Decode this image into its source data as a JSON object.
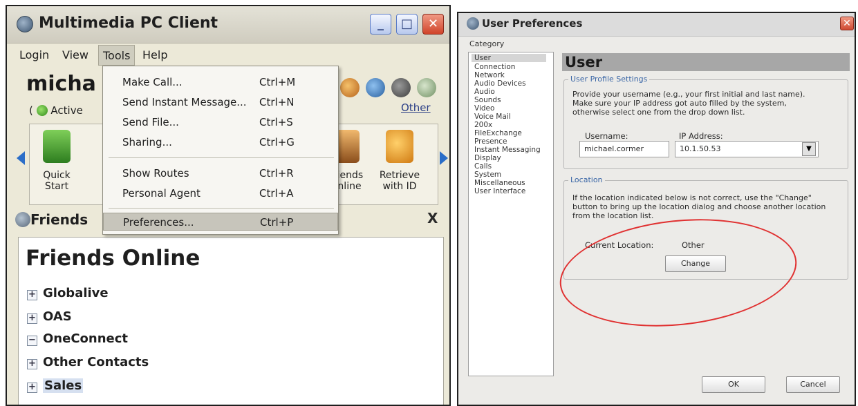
{
  "client": {
    "title": "Multimedia PC Client",
    "window_controls": {
      "minimize": "_",
      "maximize": "□",
      "close": "✕"
    },
    "menus": [
      "Login",
      "View",
      "Tools",
      "Help"
    ],
    "user_name": "micha",
    "status": "Active",
    "other_link": "Other",
    "toolbar_buttons": [
      "Quick Start",
      "Friends Online",
      "Retrieve with ID"
    ],
    "tools_menu": {
      "items": [
        {
          "label": "Make Call...",
          "shortcut": "Ctrl+M"
        },
        {
          "label": "Send Instant Message...",
          "shortcut": "Ctrl+N"
        },
        {
          "label": "Send File...",
          "shortcut": "Ctrl+S"
        },
        {
          "label": "Sharing...",
          "shortcut": "Ctrl+G"
        },
        {
          "label": "Show Routes",
          "shortcut": "Ctrl+R"
        },
        {
          "label": "Personal Agent",
          "shortcut": "Ctrl+A"
        },
        {
          "label": "Preferences...",
          "shortcut": "Ctrl+P"
        }
      ]
    },
    "friends_tab": "Friends",
    "friends_close": "X",
    "friends_title": "Friends Online",
    "groups": [
      "Globalive",
      "OAS",
      "OneConnect",
      "Other Contacts",
      "Sales"
    ]
  },
  "prefs": {
    "title": "User Preferences",
    "close": "✕",
    "category_label": "Category",
    "categories": [
      "User",
      "Connection",
      "Network",
      "Audio Devices",
      "Audio",
      "Sounds",
      "Video",
      "Voice Mail",
      "200x",
      "FileExchange",
      "Presence",
      "Instant Messaging",
      "Display",
      "Calls",
      "System",
      "Miscellaneous",
      "User Interface"
    ],
    "section_title": "User",
    "profile_legend": "User Profile Settings",
    "profile_text": [
      "Provide your username (e.g., your first initial and last name).",
      "Make sure your IP address got auto filled by the system,",
      "otherwise select one from the drop down list."
    ],
    "username_label": "Username:",
    "username_value": "michael.cormer",
    "ip_label": "IP Address:",
    "ip_value": "10.1.50.53",
    "location_legend": "Location",
    "location_text": [
      "If the location indicated below is not correct, use the \"Change\"",
      "button to bring up the location dialog and choose another location",
      "from the location list."
    ],
    "current_location_label": "Current Location:",
    "current_location_value": "Other",
    "change_button": "Change",
    "ok_button": "OK",
    "cancel_button": "Cancel"
  },
  "colors": {
    "annotation_circle": "#e03131",
    "toolbar_arrow": "#2b6ec8",
    "legend_text": "#3a66a6"
  }
}
